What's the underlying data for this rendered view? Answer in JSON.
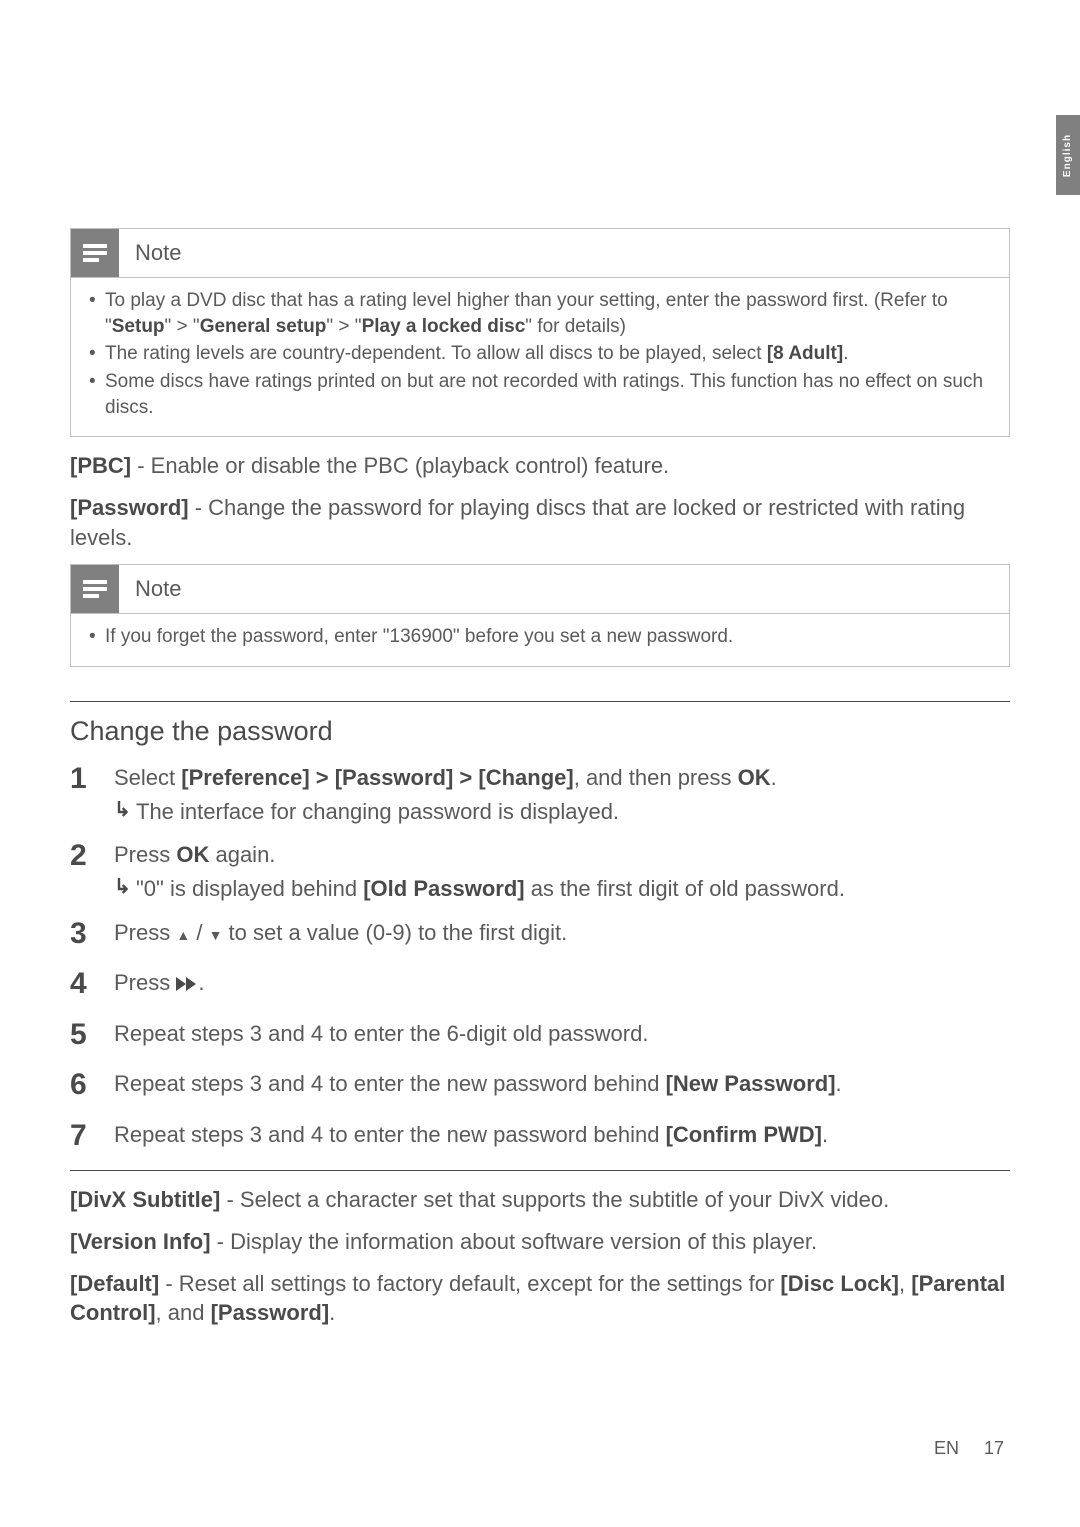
{
  "sideTab": "English",
  "note1": {
    "title": "Note",
    "items": [
      {
        "pre": "To play a DVD disc that has a rating level higher than your setting, enter the password first. (Refer to \"",
        "bold1": "Setup",
        "mid1": "\" > \"",
        "bold2": "General setup",
        "mid2": "\" > \"",
        "bold3": "Play a locked disc",
        "post": "\" for details)"
      },
      {
        "pre": "The rating levels are country-dependent. To allow all discs to be played, select ",
        "bold1": "[8 Adult]",
        "post": "."
      },
      {
        "pre": "Some discs have ratings printed on but are not recorded with ratings. This function has no effect on such discs."
      }
    ]
  },
  "paraPbc": {
    "bold": "[PBC]",
    "text": " - Enable or disable the PBC (playback control) feature."
  },
  "paraPassword": {
    "bold": "[Password]",
    "text": " - Change the password for playing discs that are locked or restricted with rating levels."
  },
  "note2": {
    "title": "Note",
    "item": "If you forget the password, enter \"136900\" before you set a new password."
  },
  "sectionTitle": "Change the password",
  "steps": {
    "s1": {
      "pre": "Select ",
      "bold": "[Preference] > [Password] > [Change]",
      "mid": ", and then press ",
      "bold2": "OK",
      "post": "."
    },
    "s1sub": "The interface for changing password is displayed.",
    "s2": {
      "pre": "Press ",
      "bold": "OK",
      "post": " again."
    },
    "s2sub": {
      "pre": "\"0\" is displayed behind ",
      "bold": "[Old Password]",
      "post": " as the first digit of old password."
    },
    "s3": {
      "pre": "Press ",
      "mid": " / ",
      "post": " to set a value (0-9) to the first digit."
    },
    "s4": {
      "pre": "Press ",
      "post": "."
    },
    "s5": "Repeat steps 3 and 4 to enter the 6-digit old password.",
    "s6": {
      "pre": "Repeat steps 3 and 4 to enter the new password behind ",
      "bold": "[New Password]",
      "post": "."
    },
    "s7": {
      "pre": "Repeat steps 3 and 4 to enter the new password behind ",
      "bold": "[Confirm PWD]",
      "post": "."
    }
  },
  "paraDivx": {
    "bold": "[DivX Subtitle]",
    "text": " - Select a character set that supports the subtitle of your DivX video."
  },
  "paraVersion": {
    "bold": "[Version Info]",
    "text": " - Display the information about software version of this player."
  },
  "paraDefault": {
    "bold1": "[Default]",
    "text1": " - Reset all settings to factory default, except for the settings for ",
    "bold2": "[Disc Lock]",
    "text2": ", ",
    "bold3": "[Parental Control]",
    "text3": ", and ",
    "bold4": "[Password]",
    "text4": "."
  },
  "footer": {
    "label": "EN",
    "page": "17"
  }
}
